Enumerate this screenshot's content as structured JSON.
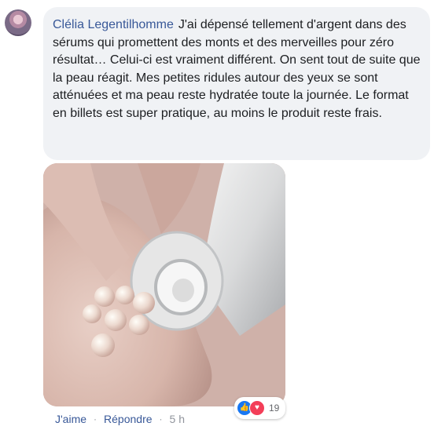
{
  "comment": {
    "author": "Clélia Legentilhomme",
    "text": "J'ai dépensé tellement d'argent dans des sérums qui promettent des monts et des merveilles pour zéro résultat… Celui-ci est vraiment différent. On sent tout de suite que la peau réagit. Mes petites ridules autour des yeux se sont atténuées et ma peau reste hydratée toute la journée. Le format en billets est super pratique, au moins le produit reste frais."
  },
  "reactions": {
    "icons": [
      "like-icon",
      "love-icon"
    ],
    "count": "19",
    "colors": {
      "like": "#1877f2",
      "love": "#f33e58"
    }
  },
  "actions": {
    "like": "J'aime",
    "reply": "Répondre",
    "time": "5 h",
    "separator": "·"
  },
  "colors": {
    "bubble_bg": "#f0f2f5",
    "author": "#385898",
    "text": "#1c1e21",
    "meta": "#90949c"
  }
}
